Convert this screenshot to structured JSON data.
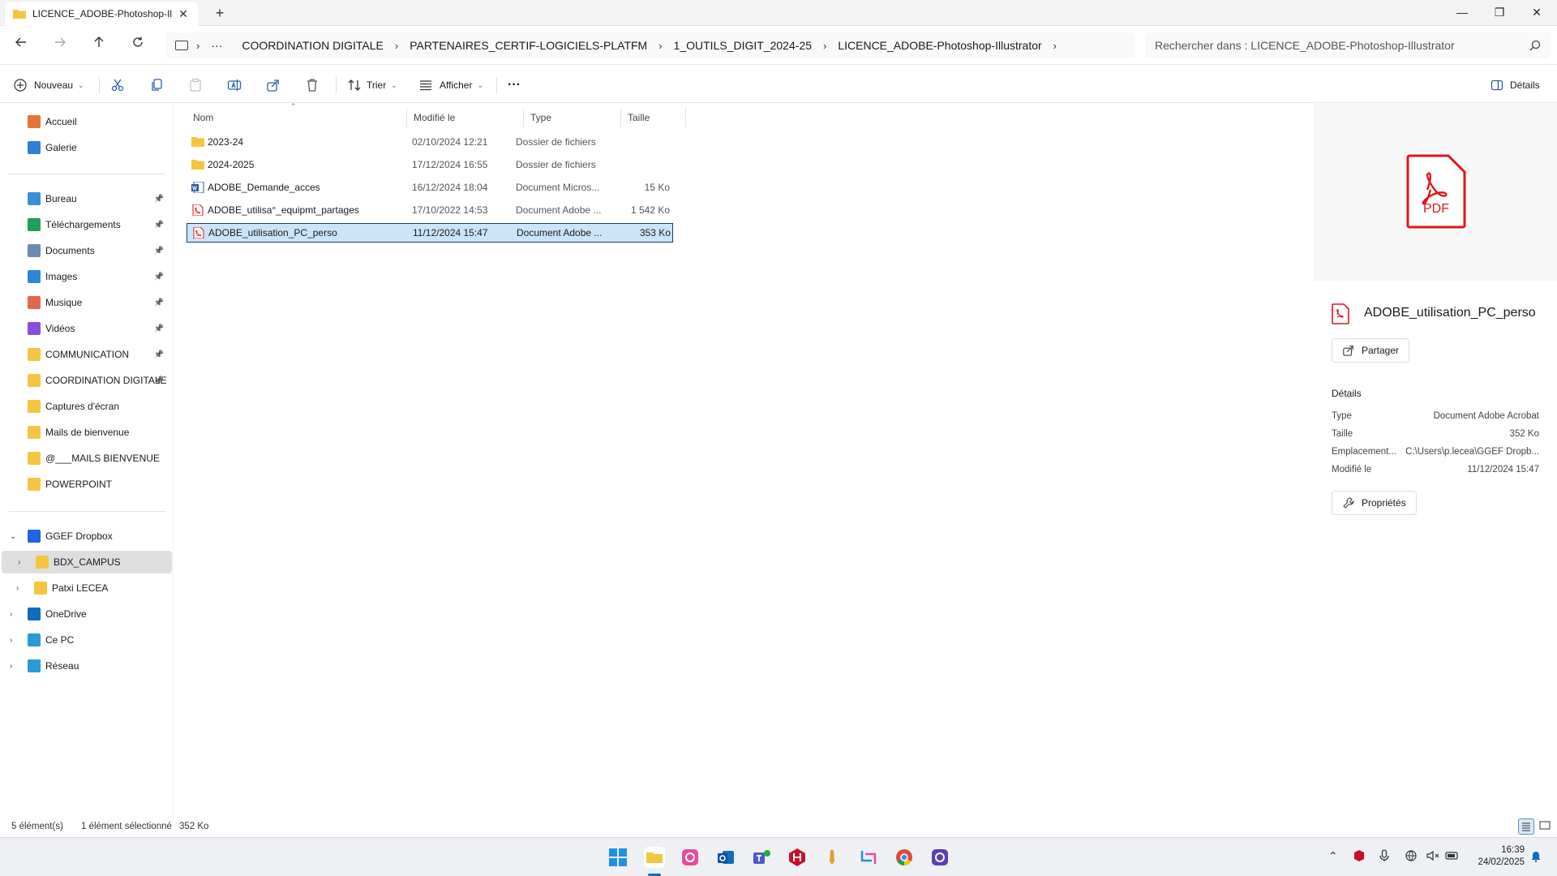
{
  "window": {
    "tab_title": "LICENCE_ADOBE-Photoshop-Il",
    "tab_close": "✕",
    "new_tab": "+",
    "minimize": "—",
    "maximize": "❐",
    "close": "✕"
  },
  "nav": {
    "more": "···",
    "breadcrumbs": [
      "COORDINATION DIGITALE",
      "PARTENAIRES_CERTIF-LOGICIELS-PLATFM",
      "1_OUTILS_DIGIT_2024-25",
      "LICENCE_ADOBE-Photoshop-Illustrator"
    ],
    "search_placeholder": "Rechercher dans : LICENCE_ADOBE-Photoshop-Illustrator"
  },
  "toolbar": {
    "new_label": "Nouveau",
    "sort_label": "Trier",
    "view_label": "Afficher",
    "more": "···",
    "details_label": "Détails"
  },
  "sidebar": {
    "top": [
      {
        "label": "Accueil",
        "icon": "home-icon",
        "color": "#e8733a"
      },
      {
        "label": "Galerie",
        "icon": "gallery-icon",
        "color": "#2f7fd6"
      }
    ],
    "quick": [
      {
        "label": "Bureau",
        "icon": "desktop-icon",
        "color": "#3b8fd9"
      },
      {
        "label": "Téléchargements",
        "icon": "download-icon",
        "color": "#1f9e5a"
      },
      {
        "label": "Documents",
        "icon": "documents-icon",
        "color": "#6c8bb3"
      },
      {
        "label": "Images",
        "icon": "images-icon",
        "color": "#2f86d6"
      },
      {
        "label": "Musique",
        "icon": "music-icon",
        "color": "#e2684c"
      },
      {
        "label": "Vidéos",
        "icon": "videos-icon",
        "color": "#8a4fd8"
      },
      {
        "label": "COMMUNICATION",
        "icon": "folder-icon",
        "color": "#f4c542"
      },
      {
        "label": "COORDINATION DIGITALE",
        "icon": "folder-icon",
        "color": "#f4c542"
      },
      {
        "label": "Captures d'écran",
        "icon": "folder-icon",
        "color": "#f4c542"
      },
      {
        "label": "Mails de bienvenue",
        "icon": "folder-icon",
        "color": "#f4c542"
      },
      {
        "label": "@___MAILS BIENVENUE",
        "icon": "folder-icon",
        "color": "#f4c542"
      },
      {
        "label": "POWERPOINT",
        "icon": "folder-icon",
        "color": "#f4c542"
      }
    ],
    "tree": [
      {
        "label": "GGEF Dropbox",
        "icon": "dropbox-icon",
        "color": "#1f64e0",
        "expanded": true
      },
      {
        "label": "BDX_CAMPUS",
        "icon": "folder-icon",
        "color": "#f4c542"
      },
      {
        "label": "Patxi LECEA",
        "icon": "folder-icon",
        "color": "#f4c542"
      },
      {
        "label": "OneDrive",
        "icon": "onedrive-icon",
        "color": "#0f6cbd"
      },
      {
        "label": "Ce PC",
        "icon": "pc-icon",
        "color": "#2b9ad6"
      },
      {
        "label": "Réseau",
        "icon": "network-icon",
        "color": "#2b9ad6"
      }
    ]
  },
  "columns": {
    "name": "Nom",
    "modified": "Modifié le",
    "type": "Type",
    "size": "Taille"
  },
  "files": [
    {
      "name": "2023-24",
      "modified": "02/10/2024 12:21",
      "type": "Dossier de fichiers",
      "size": "",
      "icon": "folder-icon"
    },
    {
      "name": "2024-2025",
      "modified": "17/12/2024 16:55",
      "type": "Dossier de fichiers",
      "size": "",
      "icon": "folder-icon"
    },
    {
      "name": "ADOBE_Demande_acces",
      "modified": "16/12/2024 18:04",
      "type": "Document Micros...",
      "size": "15 Ko",
      "icon": "word-icon"
    },
    {
      "name": "ADOBE_utilisa°_equipmt_partages",
      "modified": "17/10/2022 14:53",
      "type": "Document Adobe ...",
      "size": "1 542 Ko",
      "icon": "pdf-icon"
    },
    {
      "name": "ADOBE_utilisation_PC_perso",
      "modified": "11/12/2024 15:47",
      "type": "Document Adobe ...",
      "size": "353 Ko",
      "icon": "pdf-icon"
    }
  ],
  "details_pane": {
    "preview_label": "PDF",
    "filename": "ADOBE_utilisation_PC_perso",
    "share_label": "Partager",
    "section_title": "Détails",
    "rows": [
      {
        "key": "Type",
        "value": "Document Adobe Acrobat"
      },
      {
        "key": "Taille",
        "value": "352 Ko"
      },
      {
        "key": "Emplacement...",
        "value": "C:\\Users\\p.lecea\\GGEF Dropb..."
      },
      {
        "key": "Modifié le",
        "value": "11/12/2024 15:47"
      }
    ],
    "properties_label": "Propriétés"
  },
  "status": {
    "count": "5 élément(s)",
    "selected": "1 élément sélectionné",
    "size": "352 Ko"
  },
  "taskbar": {
    "time": "16:39",
    "date": "24/02/2025"
  },
  "colors": {
    "accent": "#0f6cbd",
    "selection": "#cce4f7",
    "pdf_red": "#e0161b"
  }
}
